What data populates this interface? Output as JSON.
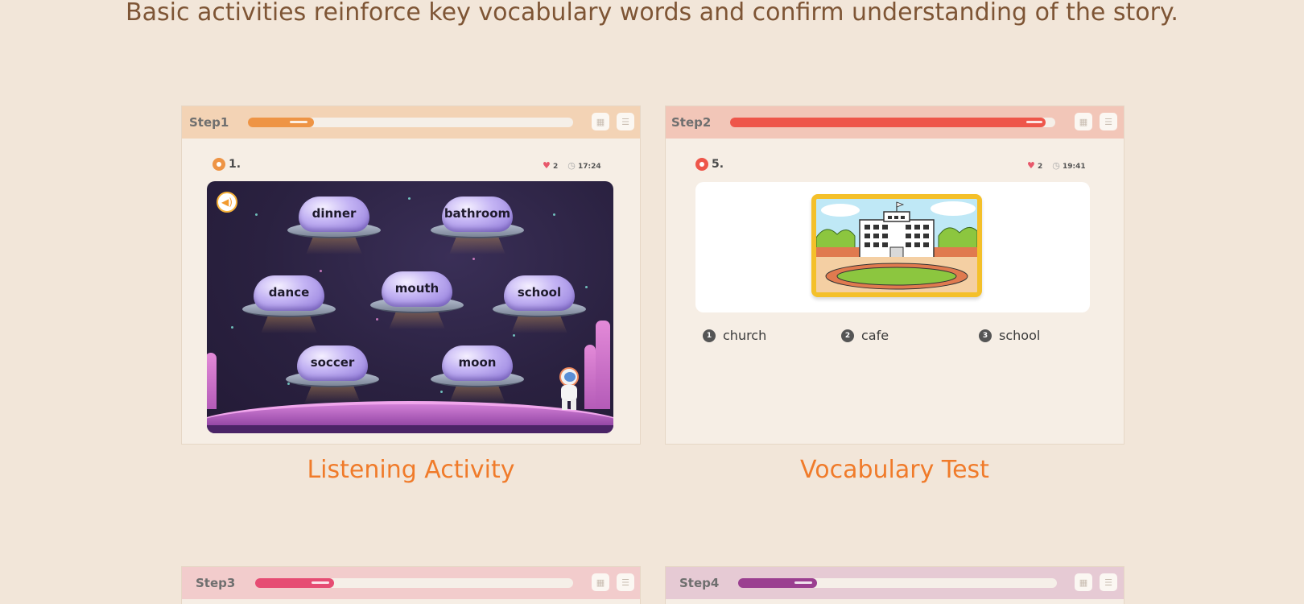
{
  "headline": "Basic activities reinforce key vocabulary words and confirm understanding of the story.",
  "colors": {
    "background": "#f2e6d9",
    "headline": "#7e5535",
    "caption": "#f07b2a",
    "step1": "#ee9445",
    "step2": "#ee564a",
    "step3": "#e64c73",
    "step4": "#9b3f90"
  },
  "cards": [
    {
      "step": "Step1",
      "progress": 0.2,
      "question_number": "1.",
      "lives": "2",
      "timer": "17:24",
      "activity": "listening",
      "words": [
        "dinner",
        "bathroom",
        "dance",
        "mouth",
        "school",
        "soccer",
        "moon"
      ],
      "icons": [
        "grid-icon",
        "list-icon",
        "speaker-icon",
        "heart-icon",
        "clock-icon"
      ],
      "caption": "Listening Activity"
    },
    {
      "step": "Step2",
      "progress": 0.97,
      "question_number": "5.",
      "lives": "2",
      "timer": "19:41",
      "activity": "vocabulary",
      "image": "school-building-picture",
      "options": [
        {
          "number": "1",
          "label": "church"
        },
        {
          "number": "2",
          "label": "cafe"
        },
        {
          "number": "3",
          "label": "school"
        }
      ],
      "caption": "Vocabulary Test"
    },
    {
      "step": "Step3",
      "progress": 0.25
    },
    {
      "step": "Step4",
      "progress": 0.25
    }
  ]
}
